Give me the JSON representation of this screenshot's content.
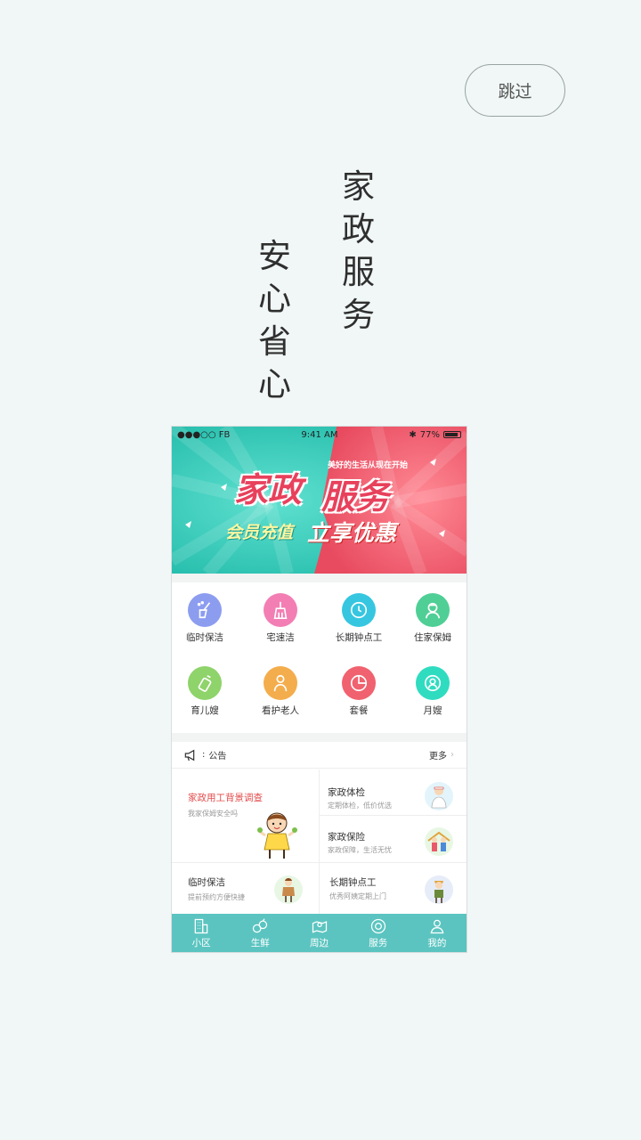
{
  "skip_label": "跳过",
  "slogan_a": [
    "家",
    "政",
    "服",
    "务"
  ],
  "slogan_b": [
    "安",
    "心",
    "省",
    "心"
  ],
  "phone": {
    "status": {
      "carrier": "●●●○○ FB",
      "time": "9:41 AM",
      "battery": "77%"
    },
    "banner": {
      "tagline": "美好的生活从现在开始",
      "title_left": "家政",
      "title_right": "服务",
      "promo_left": "会员充值",
      "promo_right": "立享优惠"
    },
    "services": [
      {
        "label": "临时保洁",
        "icon": "broom-icon",
        "color": "#8c9df0"
      },
      {
        "label": "宅速洁",
        "icon": "brush-icon",
        "color": "#f37eb4"
      },
      {
        "label": "长期钟点工",
        "icon": "clock-icon",
        "color": "#36c6e0"
      },
      {
        "label": "住家保姆",
        "icon": "nanny-icon",
        "color": "#4fcf95"
      },
      {
        "label": "育儿嫂",
        "icon": "bottle-icon",
        "color": "#8fd36b"
      },
      {
        "label": "看护老人",
        "icon": "elder-icon",
        "color": "#f4ad4c"
      },
      {
        "label": "套餐",
        "icon": "pie-icon",
        "color": "#f0626f"
      },
      {
        "label": "月嫂",
        "icon": "baby-icon",
        "color": "#2fdcc0"
      }
    ],
    "notice": {
      "label": "公告",
      "more": "更多"
    },
    "cards": [
      {
        "title": "家政用工背景调查",
        "sub": "我家保姆安全吗"
      },
      {
        "title": "家政体检",
        "sub": "定期体检，低价优选"
      },
      {
        "title": "家政保险",
        "sub": "家政保障，生活无忧"
      },
      {
        "title": "临时保洁",
        "sub": "提前预约方便快捷"
      },
      {
        "title": "长期钟点工",
        "sub": "优秀阿姨定期上门"
      }
    ],
    "tabs": [
      {
        "label": "小区",
        "icon": "building-icon"
      },
      {
        "label": "生鲜",
        "icon": "fresh-icon"
      },
      {
        "label": "周边",
        "icon": "map-icon"
      },
      {
        "label": "服务",
        "icon": "service-icon"
      },
      {
        "label": "我的",
        "icon": "user-icon"
      }
    ]
  }
}
